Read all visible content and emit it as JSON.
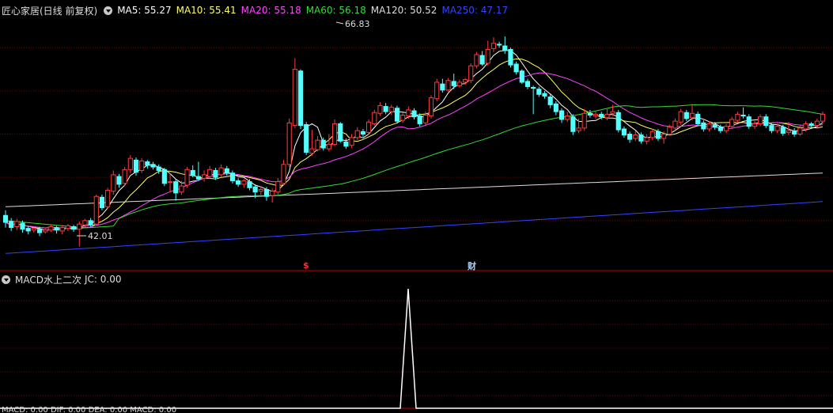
{
  "main_header": {
    "title": "匠心家居(日线 前复权)",
    "ma_items": [
      {
        "label": "MA5: 55.27",
        "color": "#ffffff"
      },
      {
        "label": "MA10: 55.41",
        "color": "#ffff66"
      },
      {
        "label": "MA20: 55.18",
        "color": "#ff44ff"
      },
      {
        "label": "MA60: 56.18",
        "color": "#33dd33"
      },
      {
        "label": "MA120: 50.52",
        "color": "#dddddd"
      },
      {
        "label": "MA250: 47.17",
        "color": "#3344ff"
      }
    ]
  },
  "indicator_header": {
    "title": "MACD水上二次",
    "value": "JC: 0.00"
  },
  "markers": {
    "high_label": "66.83",
    "low_label": "42.01",
    "event_s": "$",
    "event_cai": "财"
  },
  "bottom_header": "MACD: 0.00  DIF: 0.00  DEA: 0.00  MACD: 0.00",
  "colors": {
    "up": "#ff3b3b",
    "down": "#54ffff",
    "grid": "#7a0000",
    "separator": "#c00000"
  },
  "chart_data": {
    "type": "candlestick",
    "ylim": [
      40.5,
      68.5
    ],
    "candles": [
      [
        45.6,
        44.8,
        46.2,
        44.2
      ],
      [
        44.9,
        44.2,
        45.3,
        43.8
      ],
      [
        44.3,
        44.9,
        45.2,
        43.9
      ],
      [
        44.7,
        44.0,
        45.0,
        43.6
      ],
      [
        44.1,
        43.8,
        44.4,
        43.4
      ],
      [
        43.9,
        44.1,
        44.3,
        43.6
      ],
      [
        44.0,
        43.6,
        44.3,
        43.2
      ],
      [
        43.7,
        43.9,
        44.2,
        43.5
      ],
      [
        43.9,
        44.3,
        44.6,
        43.7
      ],
      [
        44.2,
        43.9,
        44.4,
        43.5
      ],
      [
        43.8,
        44.2,
        44.5,
        43.4
      ],
      [
        44.1,
        44.4,
        44.6,
        43.8
      ],
      [
        44.3,
        44.0,
        44.5,
        43.7
      ],
      [
        44.0,
        44.6,
        44.9,
        42.0
      ],
      [
        44.5,
        45.0,
        45.2,
        44.2
      ],
      [
        45.0,
        44.5,
        45.3,
        44.3
      ],
      [
        44.6,
        47.8,
        48.0,
        44.5
      ],
      [
        47.7,
        46.5,
        48.0,
        46.2
      ],
      [
        46.6,
        48.5,
        48.8,
        46.4
      ],
      [
        48.4,
        50.3,
        50.8,
        48.0
      ],
      [
        50.1,
        49.2,
        50.4,
        48.8
      ],
      [
        49.3,
        50.9,
        51.2,
        49.0
      ],
      [
        50.9,
        52.2,
        52.6,
        50.5
      ],
      [
        52.0,
        50.6,
        52.3,
        50.2
      ],
      [
        50.8,
        51.9,
        52.2,
        50.5
      ],
      [
        51.8,
        51.4,
        52.0,
        51.0
      ],
      [
        51.5,
        51.2,
        51.8,
        50.9
      ],
      [
        51.2,
        50.8,
        51.5,
        50.4
      ],
      [
        50.9,
        49.3,
        51.1,
        49.0
      ],
      [
        49.4,
        49.5,
        50.5,
        48.3
      ],
      [
        49.5,
        48.2,
        49.8,
        47.3
      ],
      [
        48.3,
        49.0,
        49.6,
        48.0
      ],
      [
        49.1,
        50.9,
        51.2,
        48.8
      ],
      [
        50.8,
        50.2,
        51.4,
        50.0
      ],
      [
        50.1,
        49.8,
        51.8,
        49.6
      ],
      [
        49.9,
        50.3,
        50.8,
        49.5
      ],
      [
        50.1,
        50.9,
        51.3,
        49.8
      ],
      [
        50.8,
        50.0,
        51.1,
        49.7
      ],
      [
        50.3,
        51.1,
        51.5,
        50.0
      ],
      [
        51.0,
        50.5,
        51.3,
        50.2
      ],
      [
        50.5,
        49.6,
        50.8,
        49.3
      ],
      [
        49.6,
        49.2,
        49.9,
        48.9
      ],
      [
        49.2,
        49.6,
        49.8,
        48.8
      ],
      [
        49.5,
        48.8,
        49.8,
        48.5
      ],
      [
        48.9,
        48.3,
        49.2,
        47.6
      ],
      [
        48.4,
        48.6,
        49.0,
        48.0
      ],
      [
        48.6,
        47.8,
        48.9,
        47.3
      ],
      [
        47.9,
        48.4,
        48.7,
        47.1
      ],
      [
        48.3,
        49.5,
        49.9,
        48.0
      ],
      [
        49.3,
        51.5,
        52.0,
        49.1
      ],
      [
        51.5,
        56.3,
        56.8,
        51.2
      ],
      [
        56.0,
        62.5,
        63.8,
        55.7
      ],
      [
        62.3,
        56.0,
        62.5,
        55.6
      ],
      [
        56.1,
        52.9,
        56.4,
        52.6
      ],
      [
        52.8,
        53.3,
        55.5,
        52.5
      ],
      [
        53.2,
        54.3,
        54.8,
        53.0
      ],
      [
        54.3,
        53.4,
        54.6,
        53.1
      ],
      [
        53.3,
        53.8,
        55.0,
        53.0
      ],
      [
        53.8,
        56.2,
        56.7,
        53.6
      ],
      [
        56.2,
        54.2,
        56.4,
        54.0
      ],
      [
        54.1,
        53.6,
        54.5,
        53.3
      ],
      [
        53.7,
        54.6,
        55.0,
        53.4
      ],
      [
        54.6,
        55.4,
        55.8,
        54.3
      ],
      [
        55.3,
        55.0,
        55.6,
        54.7
      ],
      [
        55.2,
        56.4,
        56.7,
        55.0
      ],
      [
        56.2,
        57.5,
        57.8,
        56.0
      ],
      [
        57.4,
        58.3,
        58.7,
        57.1
      ],
      [
        58.2,
        57.6,
        58.6,
        57.3
      ],
      [
        57.6,
        58.1,
        58.4,
        57.2
      ],
      [
        58.0,
        56.5,
        58.3,
        56.2
      ],
      [
        56.6,
        57.2,
        57.5,
        56.3
      ],
      [
        57.1,
        57.8,
        58.2,
        56.8
      ],
      [
        57.7,
        57.0,
        58.0,
        56.7
      ],
      [
        57.1,
        56.2,
        57.4,
        55.9
      ],
      [
        56.3,
        57.2,
        57.6,
        56.0
      ],
      [
        57.1,
        59.2,
        59.5,
        56.8
      ],
      [
        59.1,
        61.0,
        61.4,
        58.8
      ],
      [
        60.8,
        60.1,
        61.4,
        59.8
      ],
      [
        60.1,
        61.2,
        61.5,
        59.9
      ],
      [
        61.1,
        60.6,
        62.0,
        60.2
      ],
      [
        60.6,
        61.0,
        61.3,
        60.4
      ],
      [
        61.0,
        61.3,
        61.5,
        60.7
      ],
      [
        61.2,
        62.9,
        63.2,
        60.9
      ],
      [
        62.9,
        64.2,
        64.5,
        62.6
      ],
      [
        64.1,
        63.1,
        64.6,
        62.9
      ],
      [
        63.2,
        64.8,
        65.8,
        62.9
      ],
      [
        64.9,
        65.5,
        66.2,
        64.5
      ],
      [
        65.4,
        65.3,
        65.7,
        65.0
      ],
      [
        65.2,
        64.7,
        66.3,
        64.3
      ],
      [
        64.8,
        63.0,
        65.0,
        62.7
      ],
      [
        63.1,
        62.2,
        63.4,
        61.9
      ],
      [
        62.3,
        61.0,
        62.5,
        60.8
      ],
      [
        61.1,
        60.5,
        61.4,
        60.2
      ],
      [
        60.4,
        60.3,
        60.6,
        57.3
      ],
      [
        60.2,
        59.6,
        60.5,
        59.3
      ],
      [
        59.7,
        59.4,
        60.0,
        59.1
      ],
      [
        59.3,
        58.4,
        59.6,
        58.0
      ],
      [
        58.5,
        57.6,
        58.8,
        57.2
      ],
      [
        57.7,
        56.7,
        58.0,
        56.3
      ],
      [
        56.7,
        57.1,
        57.6,
        56.4
      ],
      [
        57.0,
        55.3,
        57.3,
        54.9
      ],
      [
        55.4,
        55.7,
        56.8,
        55.1
      ],
      [
        55.7,
        57.4,
        57.9,
        55.4
      ],
      [
        57.4,
        57.2,
        57.8,
        56.9
      ],
      [
        57.1,
        57.3,
        57.6,
        56.8
      ],
      [
        57.3,
        57.0,
        57.6,
        56.7
      ],
      [
        56.9,
        57.3,
        57.9,
        56.6
      ],
      [
        57.4,
        57.6,
        58.4,
        57.1
      ],
      [
        57.5,
        55.5,
        57.8,
        55.2
      ],
      [
        55.6,
        54.9,
        55.9,
        54.6
      ],
      [
        55.0,
        54.4,
        55.3,
        54.0
      ],
      [
        54.5,
        54.9,
        55.4,
        54.2
      ],
      [
        54.9,
        54.2,
        55.2,
        53.9
      ],
      [
        54.2,
        54.6,
        55.0,
        53.8
      ],
      [
        54.6,
        55.3,
        55.6,
        54.3
      ],
      [
        55.3,
        54.5,
        55.6,
        54.2
      ],
      [
        54.5,
        55.0,
        55.3,
        53.9
      ],
      [
        55.0,
        55.8,
        56.1,
        54.8
      ],
      [
        55.7,
        56.5,
        56.8,
        55.4
      ],
      [
        56.4,
        57.6,
        57.9,
        56.1
      ],
      [
        57.5,
        56.8,
        57.8,
        56.5
      ],
      [
        56.9,
        57.4,
        58.5,
        56.6
      ],
      [
        57.3,
        56.2,
        57.6,
        55.9
      ],
      [
        56.3,
        55.6,
        56.6,
        55.3
      ],
      [
        55.6,
        56.2,
        56.5,
        55.3
      ],
      [
        56.1,
        55.8,
        56.4,
        55.5
      ],
      [
        55.8,
        55.4,
        56.1,
        55.1
      ],
      [
        55.4,
        55.9,
        56.2,
        55.1
      ],
      [
        55.9,
        56.7,
        57.0,
        55.6
      ],
      [
        56.6,
        57.3,
        57.6,
        56.3
      ],
      [
        57.2,
        57.1,
        58.1,
        56.8
      ],
      [
        57.0,
        55.9,
        57.3,
        55.6
      ],
      [
        55.9,
        56.2,
        56.5,
        55.6
      ],
      [
        56.2,
        57.0,
        57.3,
        55.9
      ],
      [
        57.0,
        56.0,
        57.3,
        55.7
      ],
      [
        56.0,
        55.4,
        56.3,
        55.1
      ],
      [
        55.4,
        55.9,
        56.2,
        55.1
      ],
      [
        55.8,
        55.1,
        56.1,
        54.8
      ],
      [
        55.2,
        55.4,
        56.4,
        54.9
      ],
      [
        55.3,
        55.0,
        55.7,
        54.7
      ],
      [
        55.0,
        55.7,
        56.0,
        54.8
      ],
      [
        55.6,
        56.2,
        56.5,
        55.3
      ],
      [
        56.2,
        56.0,
        56.4,
        55.7
      ],
      [
        56.0,
        56.5,
        56.8,
        55.8
      ],
      [
        56.5,
        57.3,
        57.6,
        56.2
      ]
    ],
    "indicator": {
      "ylim": [
        0,
        1
      ],
      "spike_index": 89,
      "spike_value": 1
    }
  }
}
